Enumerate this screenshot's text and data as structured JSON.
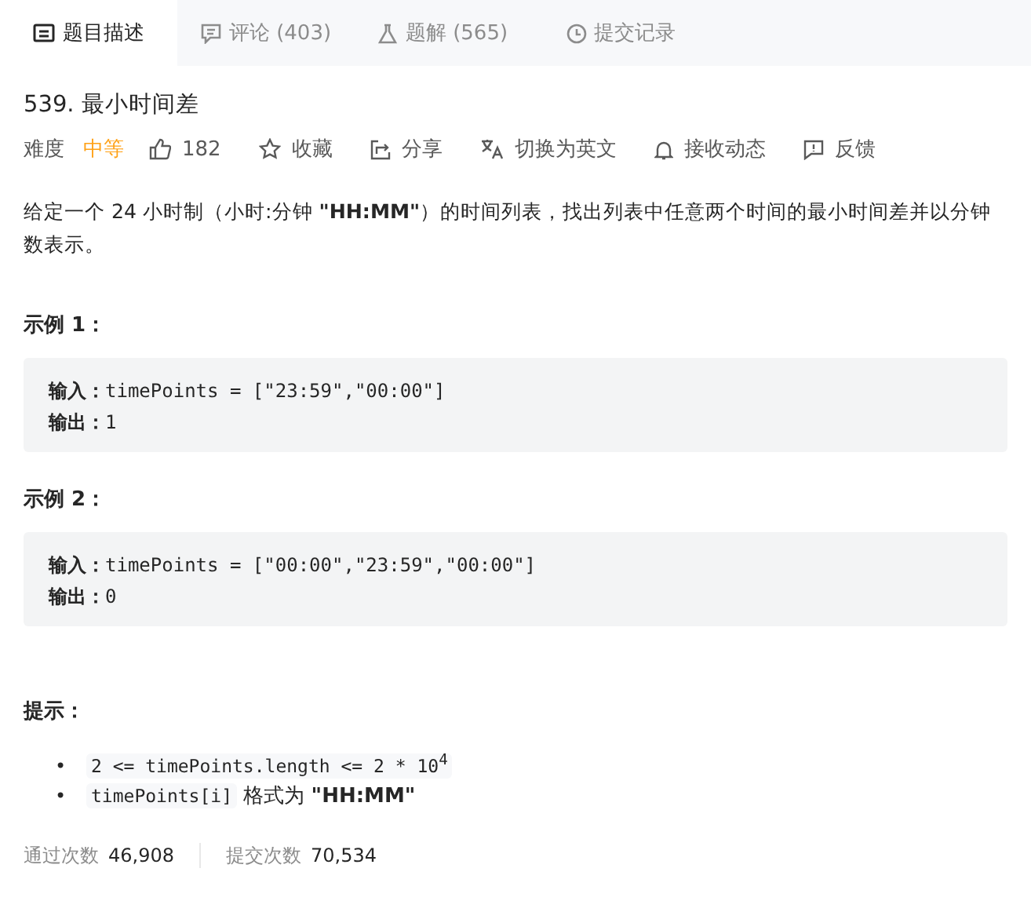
{
  "tabs": [
    {
      "label": "题目描述",
      "selected": true
    },
    {
      "label": "评论 (403)",
      "selected": false
    },
    {
      "label": "题解 (565)",
      "selected": false
    },
    {
      "label": "提交记录",
      "selected": false
    }
  ],
  "problem": {
    "title": "539. 最小时间差",
    "difficulty_label": "难度",
    "difficulty": "中等",
    "actions": [
      {
        "label": "182"
      },
      {
        "label": "收藏"
      },
      {
        "label": "分享"
      },
      {
        "label": "切换为英文"
      },
      {
        "label": "接收动态"
      },
      {
        "label": "反馈"
      }
    ]
  },
  "description": "给定一个 24 小时制（小时:分钟 **\"HH:MM\"**）的时间列表，找出列表中任意两个时间的最小时间差并以分钟数表示。",
  "examples": [
    {
      "heading": "示例 1：",
      "input_label": "输入：",
      "input": "timePoints = [\"23:59\",\"00:00\"]",
      "output_label": "输出：",
      "output": "1"
    },
    {
      "heading": "示例 2：",
      "input_label": "输入：",
      "input": "timePoints = [\"00:00\",\"23:59\",\"00:00\"]",
      "output_label": "输出：",
      "output": "0"
    }
  ],
  "hints": {
    "heading": "提示：",
    "items": [
      {
        "bullet": "•",
        "parts": [
          {
            "kind": "code",
            "text": "2 <= timePoints.length <= 2 * 10$^{4}$"
          }
        ]
      },
      {
        "bullet": "•",
        "parts": [
          {
            "kind": "code",
            "text": "timePoints[i]"
          },
          {
            "kind": "text",
            "text": "格式为 **\"HH:MM\"**"
          }
        ]
      }
    ]
  },
  "stats": [
    {
      "label": "通过次数",
      "value": "46,908"
    },
    {
      "label": "提交次数",
      "value": "70,534"
    }
  ]
}
